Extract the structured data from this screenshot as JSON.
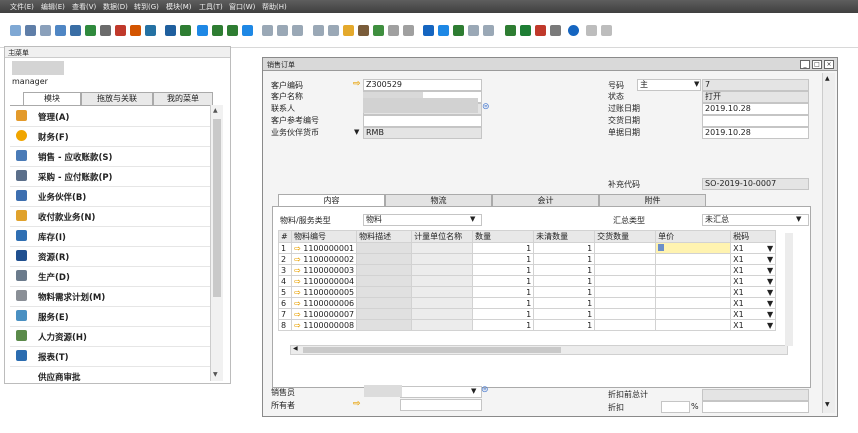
{
  "menu": [
    "文件(E)",
    "编辑(E)",
    "查看(V)",
    "数据(D)",
    "转到(G)",
    "模块(M)",
    "工具(T)",
    "窗口(W)",
    "帮助(H)"
  ],
  "left_panel": {
    "title": "主菜单",
    "username": "manager",
    "tabs": [
      "模块",
      "拖放与关联",
      "我的菜单"
    ],
    "modules": [
      "管理(A)",
      "财务(F)",
      "销售 - 应收账款(S)",
      "采购 - 应付账款(P)",
      "业务伙伴(B)",
      "收付款业务(N)",
      "库存(I)",
      "资源(R)",
      "生产(D)",
      "物料需求计划(M)",
      "服务(E)",
      "人力资源(H)",
      "报表(T)",
      "供应商审批"
    ],
    "module_icons": [
      "admin-icon",
      "finance-icon",
      "sales-icon",
      "purchase-icon",
      "partner-icon",
      "payment-icon",
      "inventory-icon",
      "resource-icon",
      "production-icon",
      "mrp-icon",
      "service-icon",
      "hr-icon",
      "report-icon",
      "approval-icon"
    ]
  },
  "form": {
    "title": "销售订单",
    "customer_code_label": "客户编码",
    "customer_code": "Z300529",
    "customer_name_label": "客户名称",
    "contact_label": "联系人",
    "customer_ref_label": "客户参考编号",
    "currency_label": "业务伙伴货币",
    "currency": "RMB",
    "number_label": "号码",
    "series": "主",
    "number": "7",
    "status_label": "状态",
    "status": "打开",
    "post_date_label": "过账日期",
    "post_date": "2019.10.28",
    "delivery_date_label": "交货日期",
    "delivery_date": "",
    "doc_date_label": "单据日期",
    "doc_date": "2019.10.28",
    "supp_code_label": "补充代码",
    "supp_code": "SO-2019-10-0007",
    "tabs": [
      "内容",
      "物流",
      "会计",
      "附件"
    ],
    "item_type_label": "物料/服务类型",
    "item_type": "物料",
    "summary_type_label": "汇总类型",
    "summary_type": "未汇总",
    "columns": [
      "#",
      "物料编号",
      "物料描述",
      "计量单位名称",
      "数量",
      "未清数量",
      "交货数量",
      "单价",
      "税码"
    ],
    "rows": [
      {
        "n": "1",
        "code": "1100000001",
        "qty": "1",
        "open": "1",
        "tax": "X1"
      },
      {
        "n": "2",
        "code": "1100000002",
        "qty": "1",
        "open": "1",
        "tax": "X1"
      },
      {
        "n": "3",
        "code": "1100000003",
        "qty": "1",
        "open": "1",
        "tax": "X1"
      },
      {
        "n": "4",
        "code": "1100000004",
        "qty": "1",
        "open": "1",
        "tax": "X1"
      },
      {
        "n": "5",
        "code": "1100000005",
        "qty": "1",
        "open": "1",
        "tax": "X1"
      },
      {
        "n": "6",
        "code": "1100000006",
        "qty": "1",
        "open": "1",
        "tax": "X1"
      },
      {
        "n": "7",
        "code": "1100000007",
        "qty": "1",
        "open": "1",
        "tax": "X1"
      },
      {
        "n": "8",
        "code": "1100000008",
        "qty": "1",
        "open": "1",
        "tax": "X1"
      }
    ],
    "salesperson_label": "销售员",
    "owner_label": "所有者",
    "total_before_discount_label": "折扣前总计",
    "discount_label": "折扣",
    "percent_sign": "%"
  }
}
